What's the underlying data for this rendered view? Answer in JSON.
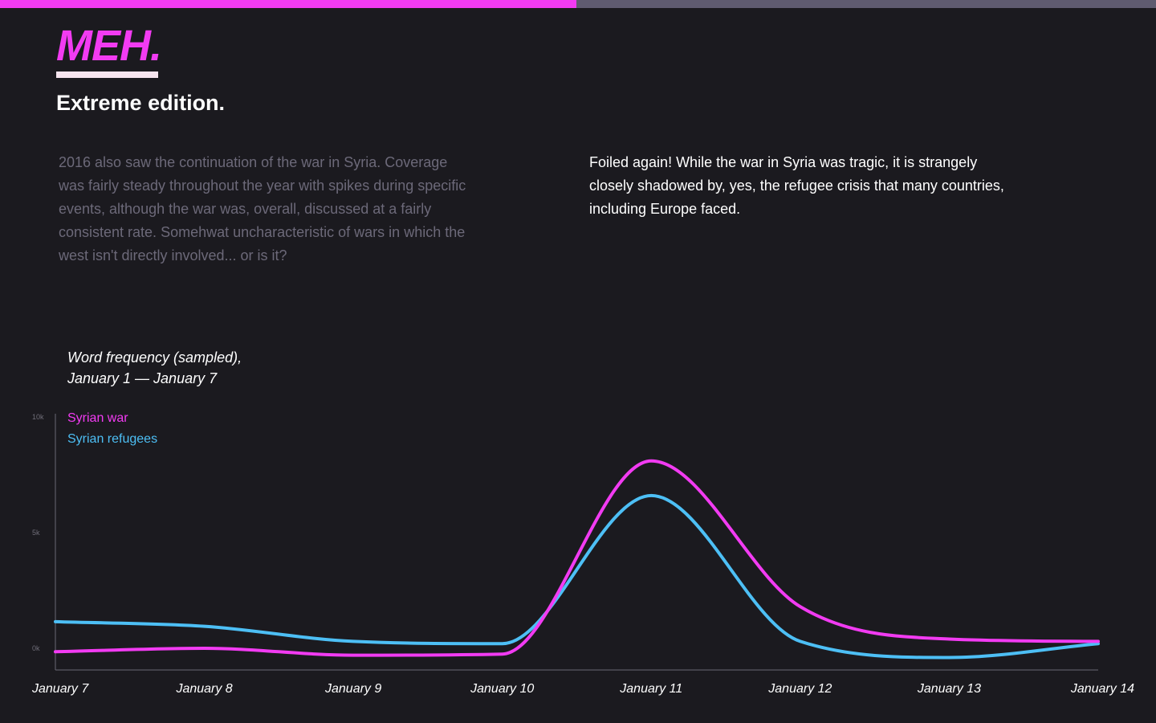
{
  "progress": {
    "fraction": 0.4986,
    "fill_color": "#f23bf2",
    "track_color": "#5f5b70"
  },
  "logo": {
    "text": "MEH."
  },
  "edition": "Extreme edition.",
  "paragraphs": {
    "left": "2016 also saw the continuation of the war in Syria. Coverage was fairly steady throughout the year with spikes during specific events, although the war was, overall, discussed at a fairly consistent rate. Somehwat uncharacteristic of wars in which the west isn't directly involved... or is it?",
    "right": "Foiled again! While the war in Syria was tragic, it is strangely closely shadowed by, yes, the refugee crisis that many countries, including Europe faced."
  },
  "chart_data": {
    "type": "line",
    "title_lines": [
      "Word frequency (sampled),",
      "January 1 — January 7"
    ],
    "categories": [
      "January 7",
      "January 8",
      "January 9",
      "January 10",
      "January 11",
      "January 12",
      "January 13",
      "January 14"
    ],
    "y_ticks": [
      {
        "value": 0,
        "label": "0k"
      },
      {
        "value": 5000,
        "label": "5k"
      },
      {
        "value": 10000,
        "label": "10k"
      }
    ],
    "ylim": [
      -900,
      10000
    ],
    "grid": false,
    "legend_position": "top-left",
    "series": [
      {
        "name": "Syrian war",
        "color": "#f23bf2",
        "values": [
          -150,
          0,
          -300,
          -250,
          8100,
          1800,
          400,
          300
        ]
      },
      {
        "name": "Syrian refugees",
        "color": "#4dbff5",
        "values": [
          1150,
          950,
          300,
          200,
          6600,
          300,
          -400,
          200
        ]
      }
    ]
  }
}
